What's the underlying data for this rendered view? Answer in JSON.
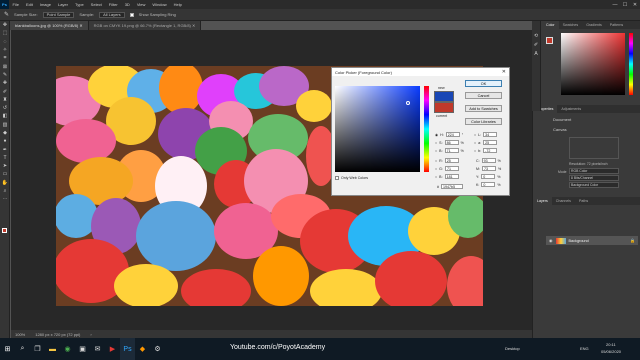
{
  "menu": {
    "app_logo": "Ps",
    "items": [
      "File",
      "Edit",
      "Image",
      "Layer",
      "Type",
      "Select",
      "Filter",
      "3D",
      "View",
      "Window",
      "Help"
    ]
  },
  "window_controls": [
    "—",
    "☐",
    "✕"
  ],
  "options_bar": {
    "sample_size_label": "Sample Size:",
    "sample_size_value": "Point Sample",
    "sample_label": "Sample:",
    "sample_value": "All Layers",
    "show_ring_label": "Show Sampling Ring"
  },
  "doc_tabs": [
    {
      "label": "blankballoons.jpg @ 100% (RGB/8)  ✕"
    },
    {
      "label": "RGB on CMYK 19.png @ 66.7% (Rectangle 1, RGB/8)  ✕"
    }
  ],
  "status": {
    "zoom": "100%",
    "doc_info": "1280 px x 720 px (72 ppi)",
    "arrow": "›"
  },
  "right_panel": {
    "top_tabs": [
      "Color",
      "Swatches",
      "Gradients",
      "Patterns"
    ],
    "mid_tabs": [
      "Properties",
      "Adjustments"
    ],
    "doc_label": "Document",
    "canvas_label": "Canvas",
    "resolution_label": "Resolution: 72 pixels/inch",
    "mode_label": "Mode",
    "mode_value": "RGB Color",
    "depth_value": "8 Bits/Channel",
    "fill_value": "Background Color",
    "layer_tabs": [
      "Layers",
      "Channels",
      "Paths"
    ],
    "layer_name": "Background"
  },
  "dialog": {
    "title": "Color Picker (Foreground Color)",
    "ok": "OK",
    "cancel": "Cancel",
    "add_swatches": "Add to Swatches",
    "color_libraries": "Color Libraries",
    "new_label": "new",
    "current_label": "current",
    "only_web": "Only Web Colors",
    "fields": {
      "H": "224",
      "S": "86",
      "B": "71",
      "R": "25",
      "G": "71",
      "Bl": "181",
      "L": "34",
      "a": "25",
      "b": "-72",
      "C": "93",
      "M": "73",
      "Y": "0",
      "K": "0",
      "hex": "1947b5",
      "deg": "°",
      "pct": "%"
    },
    "new_color": "#1947b5",
    "current_color": "#c0392b"
  },
  "taskbar": {
    "watermark": "Youtube.com/c/PoyotAcademy",
    "desktop": "Desktop",
    "lang": "ENG",
    "time": "20:11",
    "date": "05/06/2020"
  }
}
